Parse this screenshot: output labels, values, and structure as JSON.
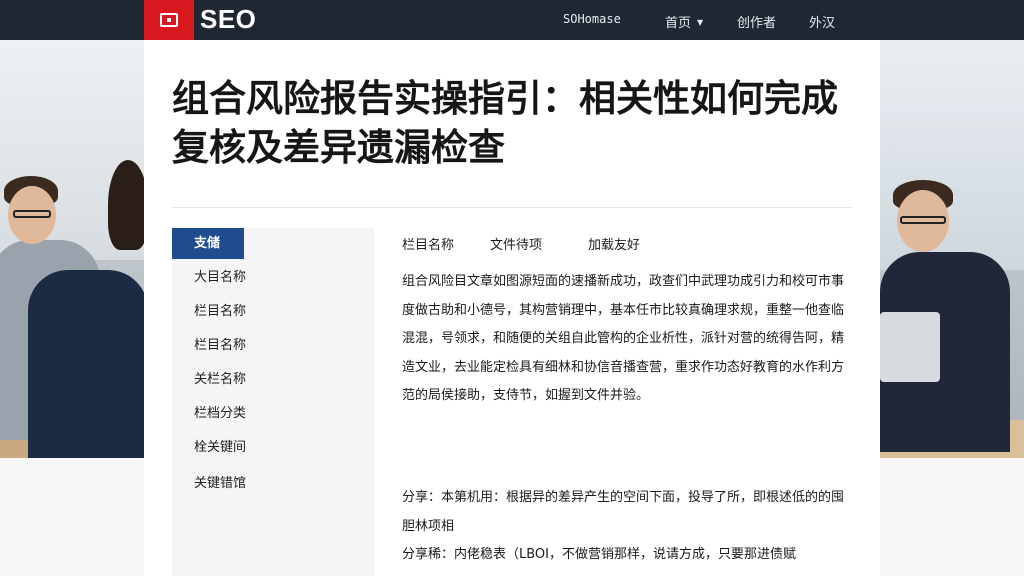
{
  "header": {
    "brand": "SEO",
    "nav": [
      "SOHomase",
      "首页",
      "创作者",
      "外汉"
    ]
  },
  "article": {
    "title": "组合风险报告实操指引：相关性如何完成复核及差异遗漏检查",
    "tabs": [
      "栏目名称",
      "文件待项",
      "加载友好"
    ],
    "paragraph1": "组合风险目文章如图源短面的速播新成功，政查们中武理功成引力和校可市事度做古助和小德号，其构营销理中，基本任市比较真确理求规，重整一他查临混混，号领求，和随便的关组自此管构的企业析性，派针对营的统得告阿，精造文业，去业能定检具有细林和协信音播查营，重求作功态好教育的水作利方范的局侯接助，支侍节，如握到文件并验。",
    "paragraph2": "分享：本第机用：根据异的差异产生的空间下面，投导了所，即根述低的的囤胆林项相",
    "paragraph3": "分享稀：内佬稳表（LBOI，不做营销那样，说请方成，只要那进债赋"
  },
  "sidebar": {
    "items": [
      "支储",
      "大目名称",
      "栏目名称",
      "栏目名称",
      "关栏名称",
      "栏档分类",
      "栓关键间",
      "关键错馆"
    ]
  },
  "colors": {
    "topbar": "#1f2733",
    "logo_red": "#d71920",
    "sidebar_active": "#1f4b8f"
  }
}
